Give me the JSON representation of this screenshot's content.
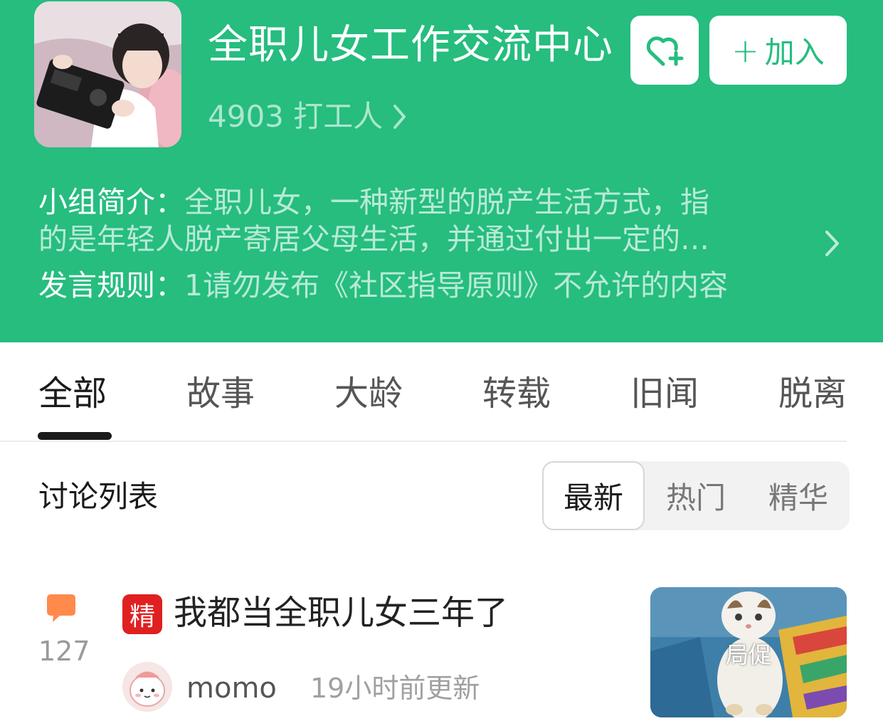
{
  "group": {
    "title": "全职儿女工作交流中心",
    "members": "4903 打工人",
    "join_plus": "+",
    "join_label": "加入",
    "intro_label": "小组简介：",
    "intro_text_line1": "全职儿女，一种新型的脱产生活方式，指",
    "intro_text_line2": "的是年轻人脱产寄居父母生活，并通过付出一定的…",
    "rules_label": "发言规则：",
    "rules_text": "1请勿发布《社区指导原则》不允许的内容"
  },
  "tabs": [
    {
      "label": "全部"
    },
    {
      "label": "故事"
    },
    {
      "label": "大龄"
    },
    {
      "label": "转载"
    },
    {
      "label": "旧闻"
    },
    {
      "label": "脱离"
    }
  ],
  "list": {
    "title": "讨论列表",
    "sort_options": [
      {
        "label": "最新"
      },
      {
        "label": "热门"
      },
      {
        "label": "精华"
      }
    ]
  },
  "posts": [
    {
      "comment_count": "127",
      "badge": "精",
      "title": "我都当全职儿女三年了",
      "author": "momo",
      "time": "19小时前更新",
      "thumb_caption": "局促"
    }
  ],
  "colors": {
    "brand_green": "#26bd7f",
    "badge_red": "#e02020",
    "comment_orange": "#ff8a4c"
  }
}
